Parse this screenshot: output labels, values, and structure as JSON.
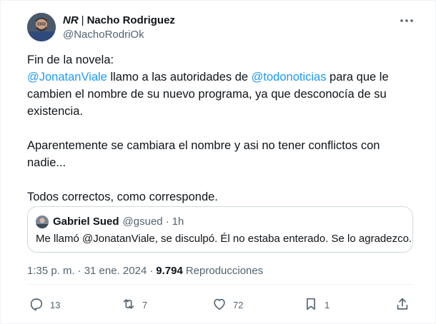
{
  "author": {
    "name_prefix": "NR",
    "name_separator": "|",
    "name": "Nacho Rodriguez",
    "handle": "@NachoRodriOk"
  },
  "tweet": {
    "line1": "Fin de la novela:",
    "mention1": "@JonatanViale",
    "text_a": " llamo a las autoridades de ",
    "mention2": "@todonoticias",
    "text_b": " para que le cambien el nombre de su nuevo programa, ya que desconocía de su existencia.",
    "paragraph2": "Aparentemente se cambiara el nombre y asi no tener conflictos con nadie...",
    "paragraph3": "Todos correctos, como corresponde."
  },
  "quote": {
    "name": "Gabriel Sued",
    "handle": "@gsued",
    "dot": "·",
    "time": "1h",
    "text": "Me llamó @JonatanViale, se disculpó. Él no estaba enterado. Se lo agradezco."
  },
  "meta": {
    "time": "1:35 p. m.",
    "dot1": "·",
    "date": "31 ene. 2024",
    "dot2": "·",
    "views": "9.794",
    "views_label": "Reproducciones"
  },
  "actions": {
    "replies": "13",
    "reposts": "7",
    "likes": "72",
    "bookmarks": "1"
  },
  "icons": [
    "more-icon",
    "reply-icon",
    "repost-icon",
    "like-icon",
    "bookmark-icon",
    "share-icon"
  ],
  "colors": {
    "link": "#1d9bf0",
    "text": "#0f1419",
    "muted": "#536471",
    "border": "#cfd9de"
  }
}
